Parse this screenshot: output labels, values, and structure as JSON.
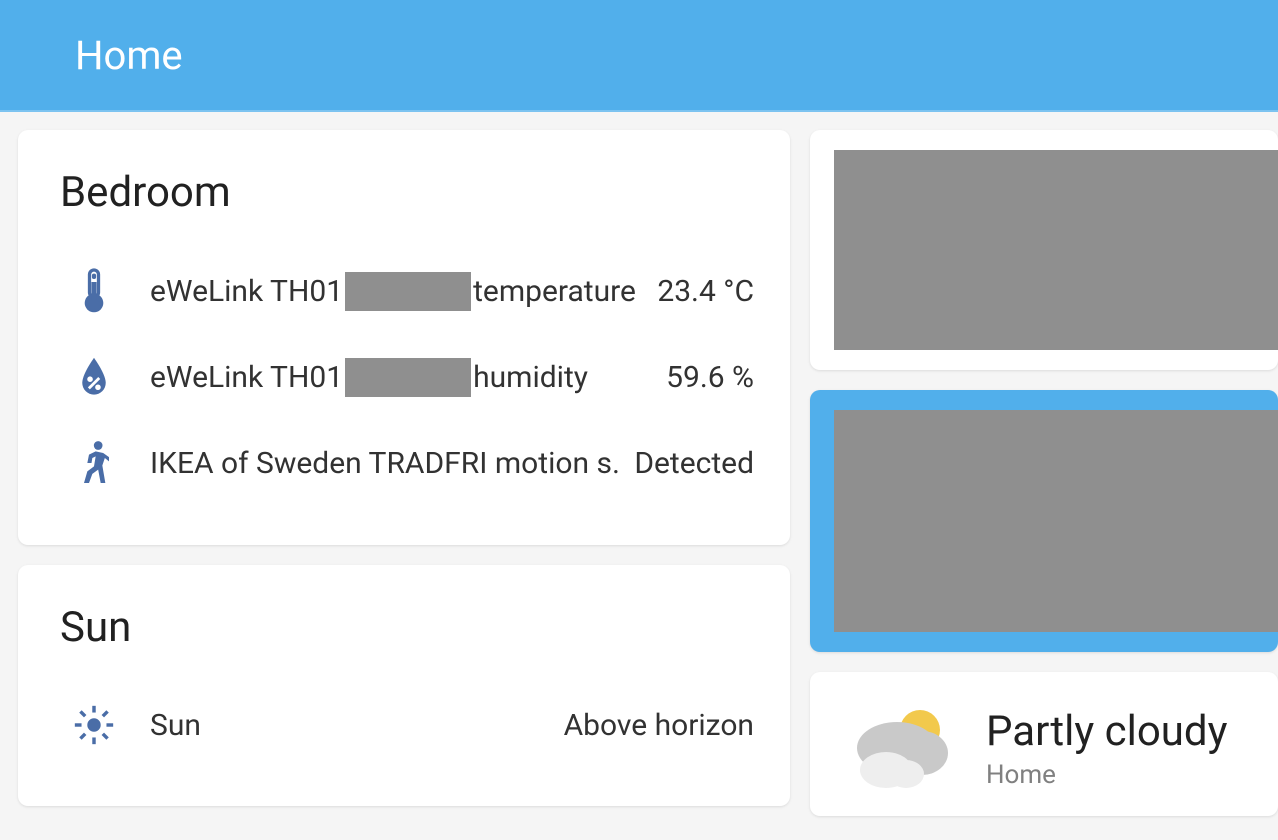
{
  "header": {
    "title": "Home"
  },
  "bedroom_card": {
    "title": "Bedroom",
    "rows": [
      {
        "icon": "thermometer",
        "name_prefix": "eWeLink TH01",
        "name_suffix": "temperature",
        "redacted_mid": true,
        "value": "23.4 °C"
      },
      {
        "icon": "water-percent",
        "name_prefix": "eWeLink TH01",
        "name_suffix": "humidity",
        "redacted_mid": true,
        "value": "59.6 %"
      },
      {
        "icon": "run",
        "name": "IKEA of Sweden TRADFRI motion s…",
        "value": "Detected"
      }
    ]
  },
  "sun_card": {
    "title": "Sun",
    "row": {
      "icon": "sun",
      "name": "Sun",
      "value": "Above horizon"
    }
  },
  "weather_card": {
    "condition": "Partly cloudy",
    "location": "Home"
  }
}
